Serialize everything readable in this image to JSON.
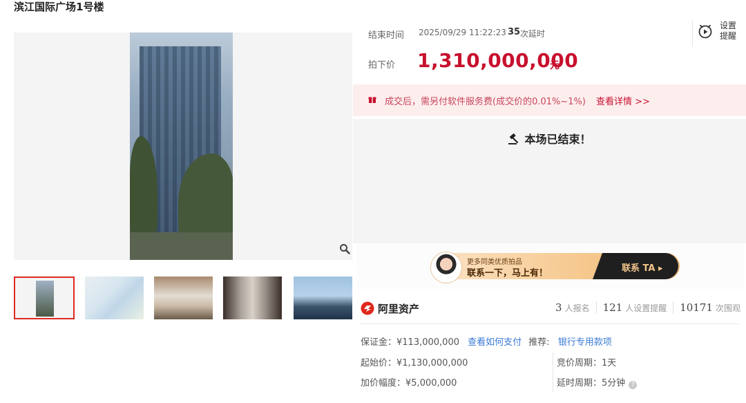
{
  "page": {
    "title": "滨江国际广场1号楼"
  },
  "auction": {
    "end_label": "结束时间",
    "end_time": "2025/09/29 11:22:23",
    "delay_count": "35",
    "delay_text": "次延时",
    "reminder_label": "设置提醒",
    "price_label": "拍下价",
    "price": "1,310,000,000",
    "price_unit": "元",
    "notice_text": "成交后，需另付软件服务费(成交价的0.01%~1%)",
    "notice_link": "查看详情 >>",
    "status": "本场已结束！"
  },
  "banner": {
    "small": "更多同类优质拍品",
    "big": "联系一下，马上有！",
    "button": "联系 TA ▸"
  },
  "brand": {
    "name": "阿里资产"
  },
  "stats": [
    {
      "num": "3",
      "label": "人报名"
    },
    {
      "num": "121",
      "label": "人设置提醒"
    },
    {
      "num": "10171",
      "label": "次围观"
    }
  ],
  "details": {
    "deposit_label": "保证金：",
    "deposit": "¥113,000,000",
    "pay_link": "查看如何支付",
    "recommend_label": "推荐:",
    "recommend_link": "银行专用款项",
    "start_price_label": "起始价：",
    "start_price": "¥1,130,000,000",
    "increment_label": "加价幅度：",
    "increment": "¥5,000,000",
    "bid_cycle_label": "竞价周期：",
    "bid_cycle": "1天",
    "delay_cycle_label": "延时周期：",
    "delay_cycle": "5分钟"
  },
  "colors": {
    "price_red": "#c8102e",
    "link_blue": "#3a7bd5",
    "notice_bg": "#fdeeee"
  },
  "icons": [
    "clock-icon",
    "gift-icon",
    "hammer-icon",
    "zoom-icon",
    "alibaba-asset-logo",
    "help-icon"
  ]
}
